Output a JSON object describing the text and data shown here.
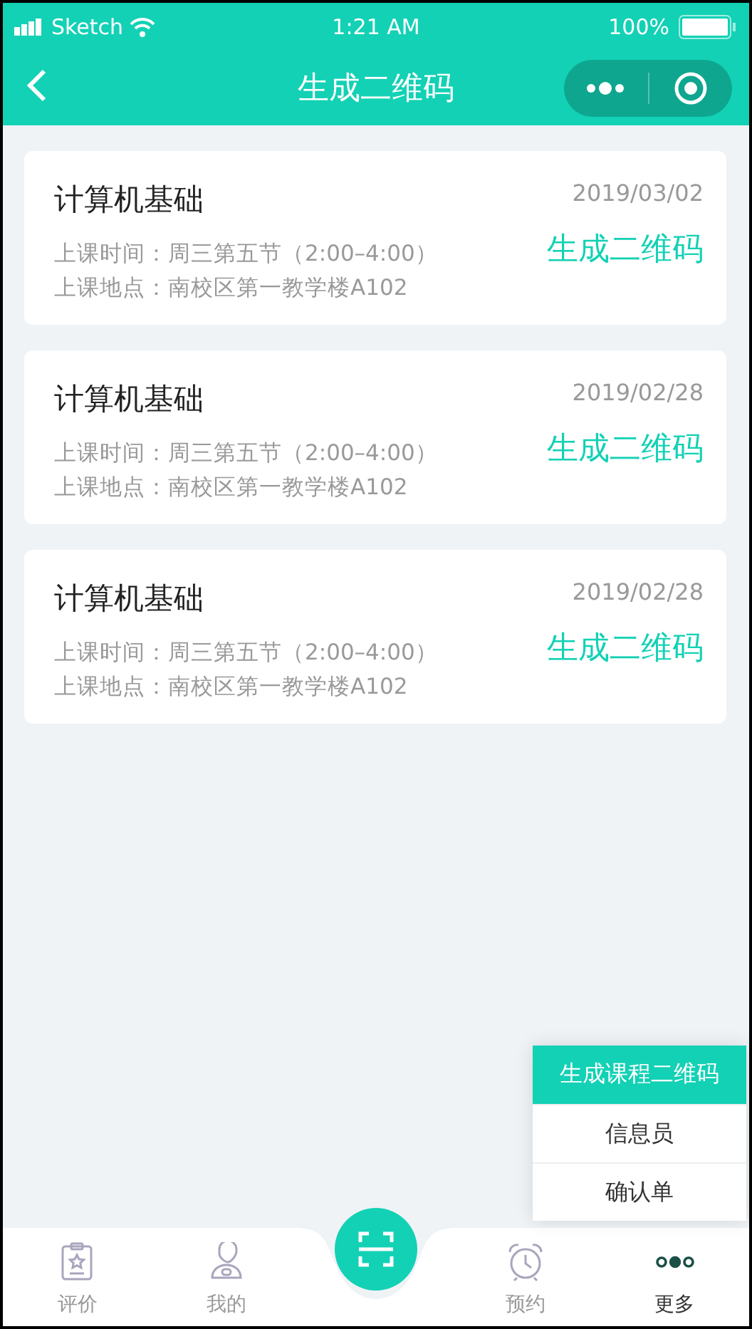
{
  "status_bar": {
    "carrier": "Sketch",
    "time": "1:21 AM",
    "battery": "100%"
  },
  "nav_bar": {
    "title": "生成二维码"
  },
  "courses": [
    {
      "name": "计算机基础",
      "date": "2019/03/02",
      "time_label": "上课时间：",
      "time": "周三第五节（2:00–4:00）",
      "place_label": "上课地点：",
      "place": "南校区第一教学楼A102",
      "action": "生成二维码"
    },
    {
      "name": "计算机基础",
      "date": "2019/02/28",
      "time_label": "上课时间：",
      "time": "周三第五节（2:00–4:00）",
      "place_label": "上课地点：",
      "place": "南校区第一教学楼A102",
      "action": "生成二维码"
    },
    {
      "name": "计算机基础",
      "date": "2019/02/28",
      "time_label": "上课时间：",
      "time": "周三第五节（2:00–4:00）",
      "place_label": "上课地点：",
      "place": "南校区第一教学楼A102",
      "action": "生成二维码"
    }
  ],
  "popup_menu": [
    {
      "label": "生成课程二维码",
      "selected": true
    },
    {
      "label": "信息员",
      "selected": false
    },
    {
      "label": "确认单",
      "selected": false
    }
  ],
  "tab_bar": [
    {
      "kind": "rate",
      "label": "评价",
      "selected": false
    },
    {
      "kind": "me",
      "label": "我的",
      "selected": false
    },
    {
      "kind": "scan",
      "selected": false
    },
    {
      "kind": "alarm",
      "label": "预约",
      "selected": false
    },
    {
      "kind": "more",
      "label": "更多",
      "selected": true
    }
  ]
}
